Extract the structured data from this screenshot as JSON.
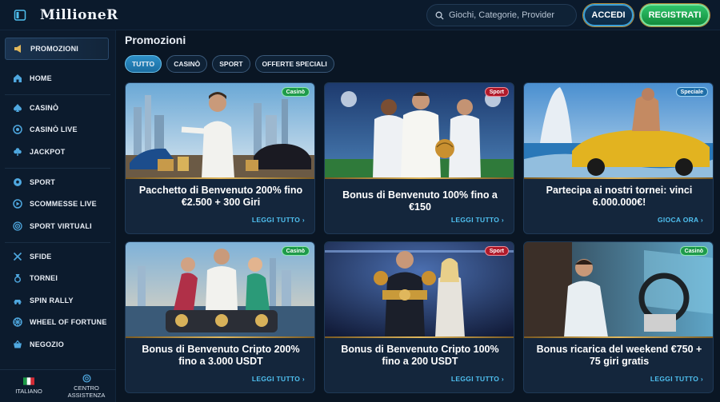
{
  "header": {
    "logo": "MillioneR",
    "search_placeholder": "Giochi, Categorie, Provider",
    "login_label": "ACCEDI",
    "register_label": "REGISTRATI"
  },
  "sidebar": {
    "items": [
      {
        "label": "PROMOZIONI",
        "icon": "megaphone-icon",
        "active": true
      },
      {
        "label": "HOME",
        "icon": "home-icon"
      },
      {
        "label": "CASINÒ",
        "icon": "spade-icon"
      },
      {
        "label": "CASINÒ LIVE",
        "icon": "chip-icon"
      },
      {
        "label": "JACKPOT",
        "icon": "clover-icon"
      },
      {
        "label": "SPORT",
        "icon": "soccer-ball-icon"
      },
      {
        "label": "SCOMMESSE LIVE",
        "icon": "live-icon"
      },
      {
        "label": "SPORT VIRTUALI",
        "icon": "target-icon"
      },
      {
        "label": "SFIDE",
        "icon": "crossed-swords-icon"
      },
      {
        "label": "TORNEI",
        "icon": "medal-icon"
      },
      {
        "label": "SPIN RALLY",
        "icon": "rally-icon"
      },
      {
        "label": "WHEEL OF FORTUNE",
        "icon": "wheel-icon"
      },
      {
        "label": "NEGOZIO",
        "icon": "basket-icon"
      }
    ],
    "footer": {
      "language": "ITALIANO",
      "support_line1": "CENTRO",
      "support_line2": "ASSISTENZA"
    }
  },
  "main": {
    "title": "Promozioni",
    "filters": [
      "TUTTO",
      "CASINÒ",
      "SPORT",
      "OFFERTE SPECIALI"
    ],
    "active_filter": "TUTTO",
    "cards": [
      {
        "badge": "Casinò",
        "badge_type": "casino",
        "title": "Pacchetto di Benvenuto 200% fino €2.500 + 300 Giri",
        "link": "LEGGI TUTTO"
      },
      {
        "badge": "Sport",
        "badge_type": "sport",
        "title": "Bonus di Benvenuto 100% fino a €150",
        "link": "LEGGI TUTTO"
      },
      {
        "badge": "Speciale",
        "badge_type": "speciale",
        "title": "Partecipa ai nostri tornei: vinci 6.000.000€!",
        "link": "GIOCA ORA"
      },
      {
        "badge": "Casinò",
        "badge_type": "casino",
        "title": "Bonus di Benvenuto Cripto 200% fino a 3.000 USDT",
        "link": "LEGGI TUTTO"
      },
      {
        "badge": "Sport",
        "badge_type": "sport",
        "title": "Bonus di Benvenuto Cripto 100% fino a 200 USDT",
        "link": "LEGGI TUTTO"
      },
      {
        "badge": "Casinò",
        "badge_type": "casino",
        "title": "Bonus ricarica del weekend €750 + 75 giri gratis",
        "link": "LEGGI TUTTO"
      }
    ]
  },
  "colors": {
    "background": "#0a1624",
    "accent_blue": "#4fc0f0",
    "gold": "#d8b25a",
    "register_green": "#2fc56a"
  }
}
